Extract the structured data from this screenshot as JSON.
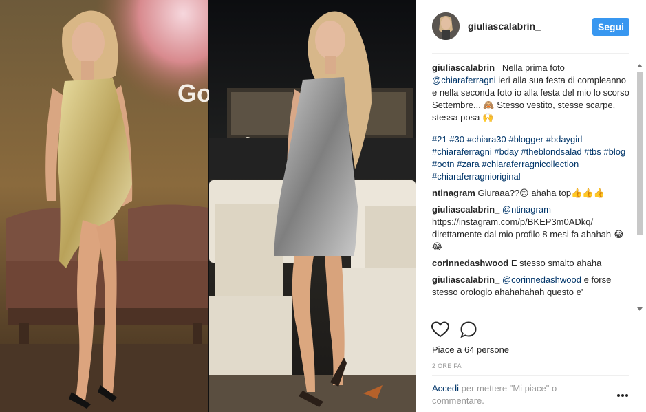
{
  "post": {
    "username": "giuliascalabrin_",
    "follow_label": "Segui",
    "caption": {
      "user": "giuliascalabrin_",
      "text_1": " Nella prima foto ",
      "mention": "@chiaraferragni",
      "text_2": " ieri alla sua festa di compleanno e nella seconda foto io alla festa del mio lo scorso Settembre... 🙈 Stesso vestito, stesse scarpe, stessa posa 🙌",
      "hashtags": [
        "#21",
        "#30",
        "#chiara30",
        "#blogger",
        "#bdaygirl",
        "#chiaraferragni",
        "#bday",
        "#theblondsalad",
        "#tbs",
        "#blog",
        "#ootn",
        "#zara",
        "#chiaraferragnicollection",
        "#chiaraferragnioriginal"
      ]
    },
    "comments": [
      {
        "user": "ntinagram",
        "mention": "",
        "text": " Giuraaa??😊 ahaha top👍👍👍"
      },
      {
        "user": "giuliascalabrin_",
        "mention": "@ntinagram",
        "text": " https://instagram.com/p/BKEP3m0ADkq/ direttamente dal mio profilo 8 mesi fa ahahah 😂😂"
      },
      {
        "user": "corinnedashwood",
        "mention": "",
        "text": " E stesso smalto ahaha"
      },
      {
        "user": "giuliascalabrin_",
        "mention": "@corinnedashwood",
        "text": " e forse stesso orologio ahahahahah questo e'"
      }
    ],
    "likes_text": "Piace a 64 persone",
    "time_text": "2 ORE FA",
    "login_link": "Accedi",
    "login_text": " per mettere \"Mi piace\" o commentare.",
    "photo_overlay_text": "Go",
    "icons": [
      "heart-icon",
      "comment-icon",
      "more-options-icon",
      "scroll-up-icon",
      "scroll-down-icon"
    ],
    "colors": {
      "follow_button": "#3897f0",
      "link": "#003569",
      "muted": "#999999"
    }
  }
}
